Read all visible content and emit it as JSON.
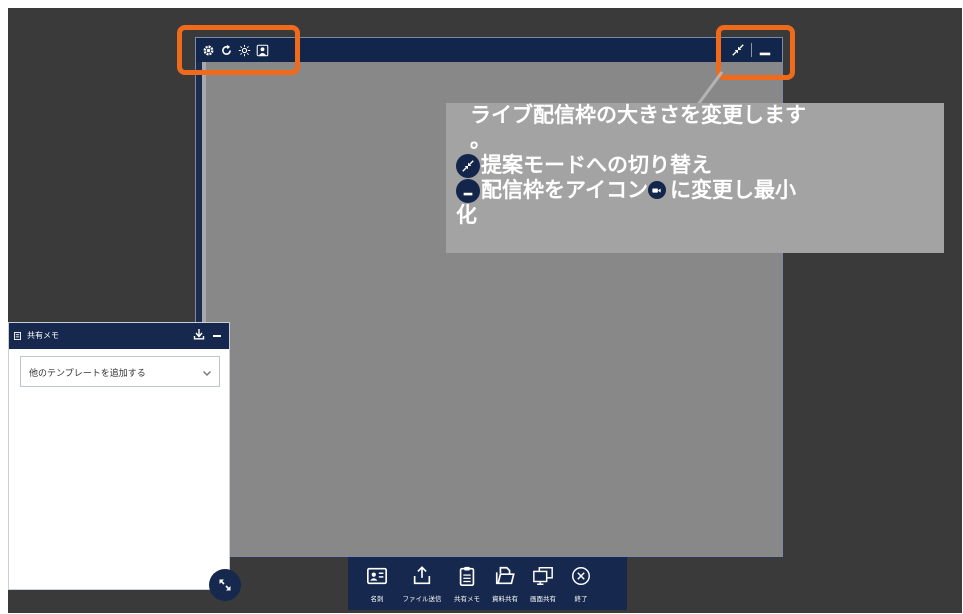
{
  "colors": {
    "accent_highlight": "#ef6a1a",
    "navy": "#16284d",
    "stage": "#3a3a3a",
    "video": "#888888",
    "callout_bg": "#a3a3a3"
  },
  "live_window": {
    "tool_icons": [
      "gear-icon",
      "refresh-icon",
      "brightness-icon",
      "person-icon"
    ],
    "controls": [
      "shrink-arrows-icon",
      "minimize-icon"
    ]
  },
  "callout": {
    "line1": "ライブ配信枠の大きさを変更します",
    "line2": "。",
    "line3": "提案モードへの切り替え",
    "line4_a": "配信枠をアイコン",
    "line4_b": "に変更し最小",
    "line5": "化"
  },
  "memo": {
    "title": "共有メモ",
    "template_select": "他のテンプレートを追加する"
  },
  "toolbar": {
    "items": [
      {
        "label": "名刺",
        "icon": "business-card-icon"
      },
      {
        "label": "ファイル送信",
        "icon": "file-upload-icon"
      },
      {
        "label": "共有メモ",
        "icon": "clipboard-icon"
      },
      {
        "label": "資料共有",
        "icon": "document-folder-icon"
      },
      {
        "label": "画面共有",
        "icon": "screen-share-icon"
      },
      {
        "label": "終了",
        "icon": "close-circle-icon"
      }
    ]
  }
}
